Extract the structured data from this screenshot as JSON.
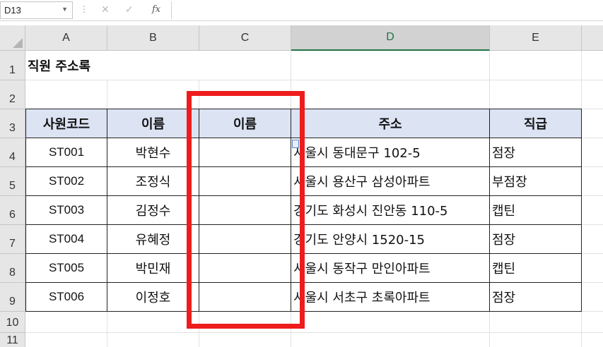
{
  "formula_bar": {
    "name_box": "D13",
    "name_box_dropdown_icon": "chevron-down-icon",
    "cancel_icon": "✕",
    "enter_icon": "✓",
    "fx_label": "fx",
    "formula_value": ""
  },
  "columns": [
    "A",
    "B",
    "C",
    "D",
    "E"
  ],
  "selected_column": "D",
  "rows": [
    "1",
    "2",
    "3",
    "4",
    "5",
    "6",
    "7",
    "8",
    "9",
    "10",
    "11"
  ],
  "sheet": {
    "title": "직원 주소록",
    "headers": [
      "사원코드",
      "이름",
      "이름",
      "주소",
      "직급"
    ],
    "records": [
      {
        "code": "ST001",
        "name": "박현수",
        "name2": "",
        "address": "서울시 동대문구 102-5",
        "rank": "점장"
      },
      {
        "code": "ST002",
        "name": "조정식",
        "name2": "",
        "address": "서울시 용산구 삼성아파트",
        "rank": "부점장"
      },
      {
        "code": "ST003",
        "name": "김정수",
        "name2": "",
        "address": "경기도 화성시 진안동 110-5",
        "rank": "캡틴"
      },
      {
        "code": "ST004",
        "name": "유혜정",
        "name2": "",
        "address": "경기도 안양시 1520-15",
        "rank": "점장"
      },
      {
        "code": "ST005",
        "name": "박민재",
        "name2": "",
        "address": "서울시 동작구 만인아파트",
        "rank": "캡틴"
      },
      {
        "code": "ST006",
        "name": "이정호",
        "name2": "",
        "address": "서울시 서초구 초록아파트",
        "rank": "점장"
      }
    ]
  },
  "colors": {
    "header_fill": "#dce3f3",
    "highlight_box": "#ee1c1c",
    "selected_col_accent": "#217346"
  }
}
